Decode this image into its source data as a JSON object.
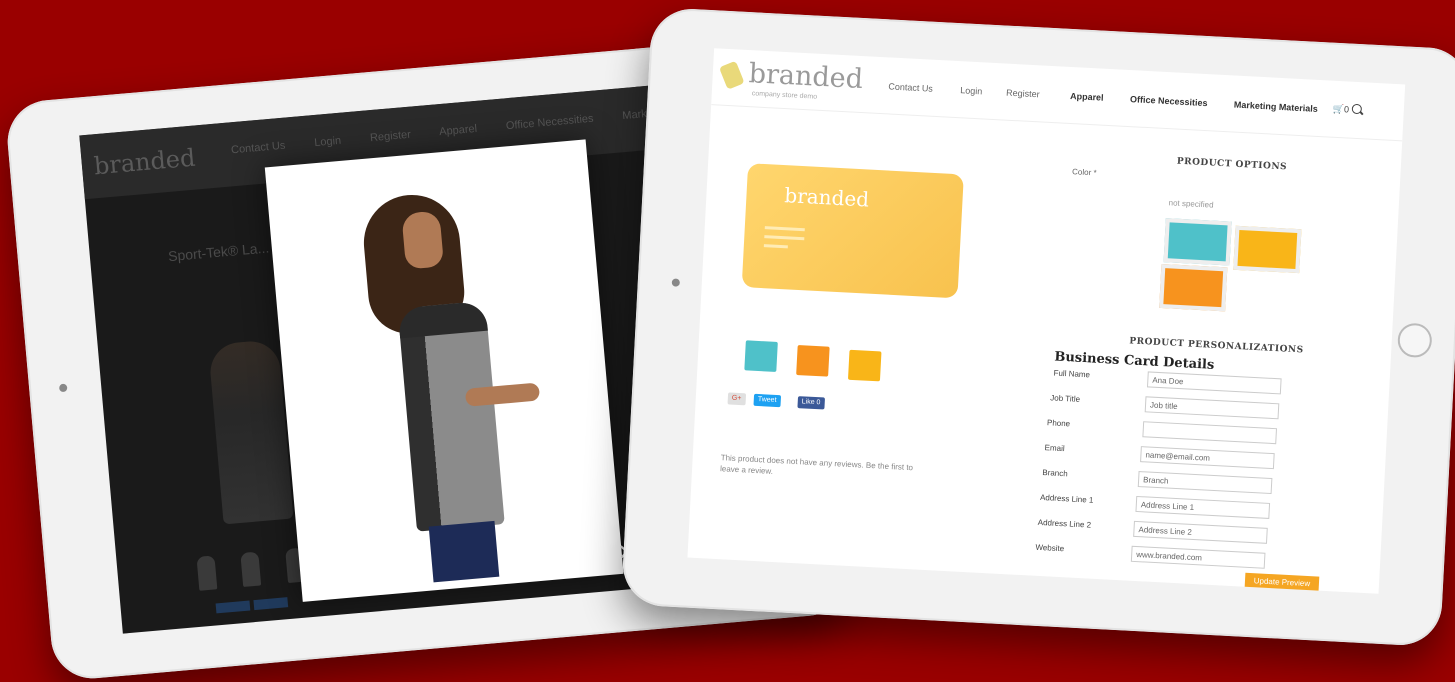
{
  "left_tablet": {
    "logo": "branded",
    "nav": [
      "Contact Us",
      "Login",
      "Register",
      "Apparel",
      "Office Necessities",
      "Marketing Mat..."
    ],
    "page_title": "Sport-Tek® La...",
    "lightbox_close": "✕"
  },
  "right_tablet": {
    "logo": "branded",
    "logo_tagline": "company store demo",
    "nav": {
      "contact": "Contact Us",
      "login": "Login",
      "register": "Register",
      "apparel": "Apparel",
      "office": "Office Necessities",
      "marketing": "Marketing Materials",
      "cart": "0"
    },
    "product_preview": {
      "logo": "branded",
      "accent": "#f8c24e"
    },
    "thumbnails": {
      "colors": [
        "#4fc1c9",
        "#f7931e",
        "#f9b518"
      ]
    },
    "social": {
      "gplus": "G+",
      "tweet": "Tweet",
      "like": "Like 0"
    },
    "reviews_note": "This product does not have any reviews. Be the first to leave a review.",
    "product_options": {
      "heading": "PRODUCT OPTIONS",
      "color_label": "Color *",
      "not_specified": "not specified",
      "swatches": [
        "#4fc1c9",
        "#f9b518",
        "#f7931e"
      ]
    },
    "personalization": {
      "heading": "PRODUCT PERSONALIZATIONS",
      "title": "Business Card Details",
      "fields": [
        {
          "label": "Full Name",
          "value": "Ana Doe"
        },
        {
          "label": "Job Title",
          "value": "Job title"
        },
        {
          "label": "Phone",
          "value": ""
        },
        {
          "label": "Email",
          "value": "name@email.com"
        },
        {
          "label": "Branch",
          "value": "Branch"
        },
        {
          "label": "Address Line 1",
          "value": "Address Line 1"
        },
        {
          "label": "Address Line 2",
          "value": "Address Line 2"
        },
        {
          "label": "Website",
          "value": "www.branded.com"
        }
      ],
      "update_button": "Update Preview"
    }
  }
}
